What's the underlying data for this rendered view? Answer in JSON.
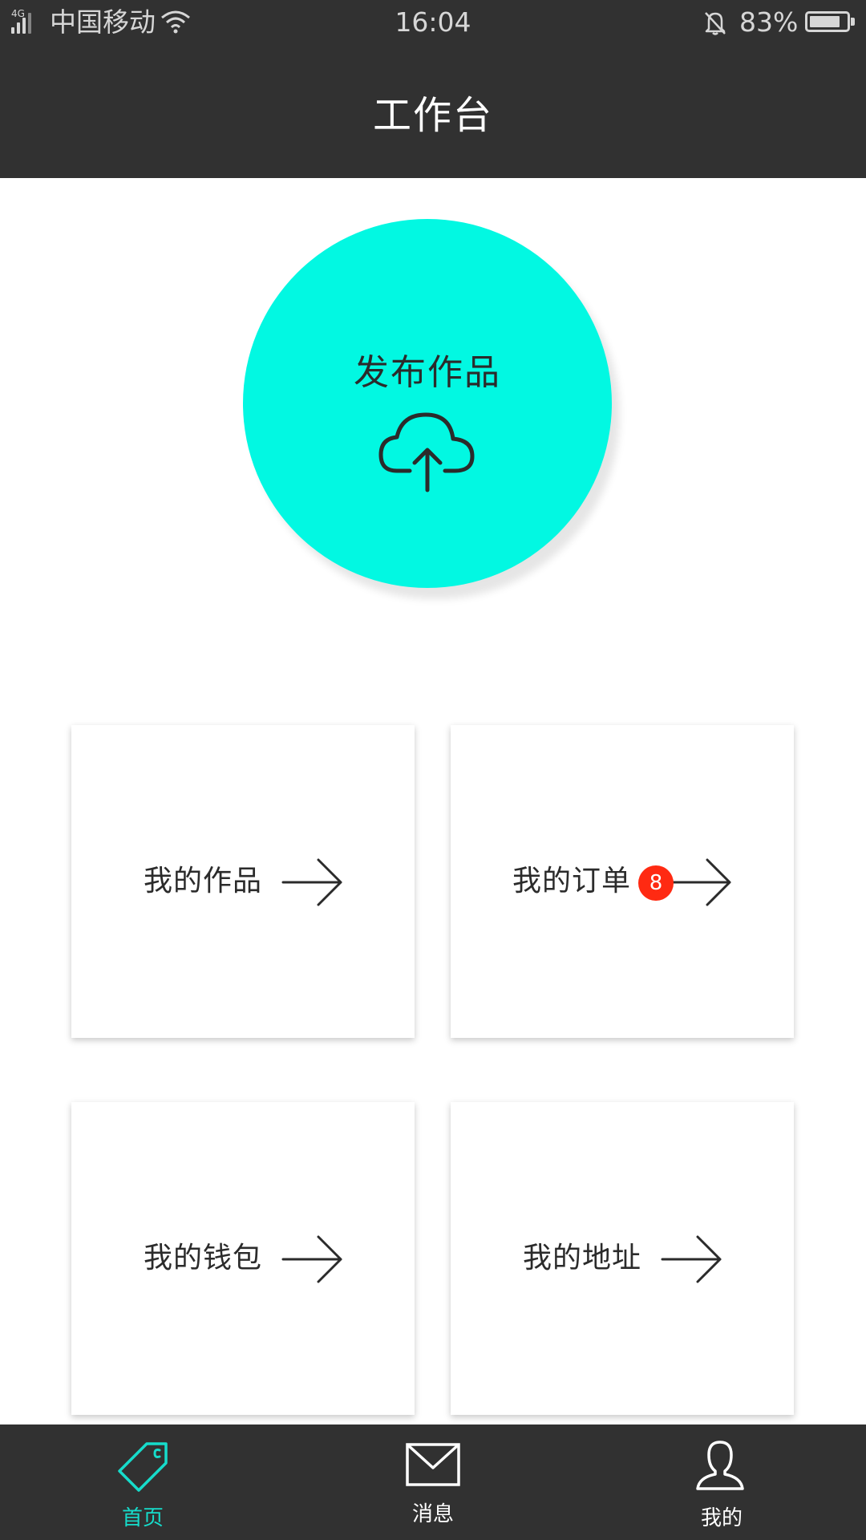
{
  "status_bar": {
    "network_type": "4G",
    "carrier": "中国移动",
    "time": "16:04",
    "battery_percent": "83%",
    "battery_level": 0.83,
    "icons": [
      "signal-icon",
      "wifi-icon",
      "bell-muted-icon",
      "battery-icon"
    ]
  },
  "header": {
    "title": "工作台"
  },
  "publish": {
    "label": "发布作品",
    "icon": "cloud-upload-icon",
    "color": "#02f8e2"
  },
  "cards": [
    {
      "label": "我的作品",
      "icon": "arrow-right-icon"
    },
    {
      "label": "我的订单",
      "icon": "arrow-right-icon",
      "badge": "8"
    },
    {
      "label": "我的钱包",
      "icon": "arrow-right-icon"
    },
    {
      "label": "我的地址",
      "icon": "arrow-right-icon"
    }
  ],
  "tab_bar": {
    "items": [
      {
        "label": "首页",
        "icon": "tag-icon",
        "active": true
      },
      {
        "label": "消息",
        "icon": "envelope-icon",
        "active": false
      },
      {
        "label": "我的",
        "icon": "user-icon",
        "active": false
      }
    ]
  },
  "colors": {
    "accent": "#02f8e2",
    "tab_active": "#16dccb",
    "bar_background": "#313131",
    "badge": "#ff2a12"
  }
}
